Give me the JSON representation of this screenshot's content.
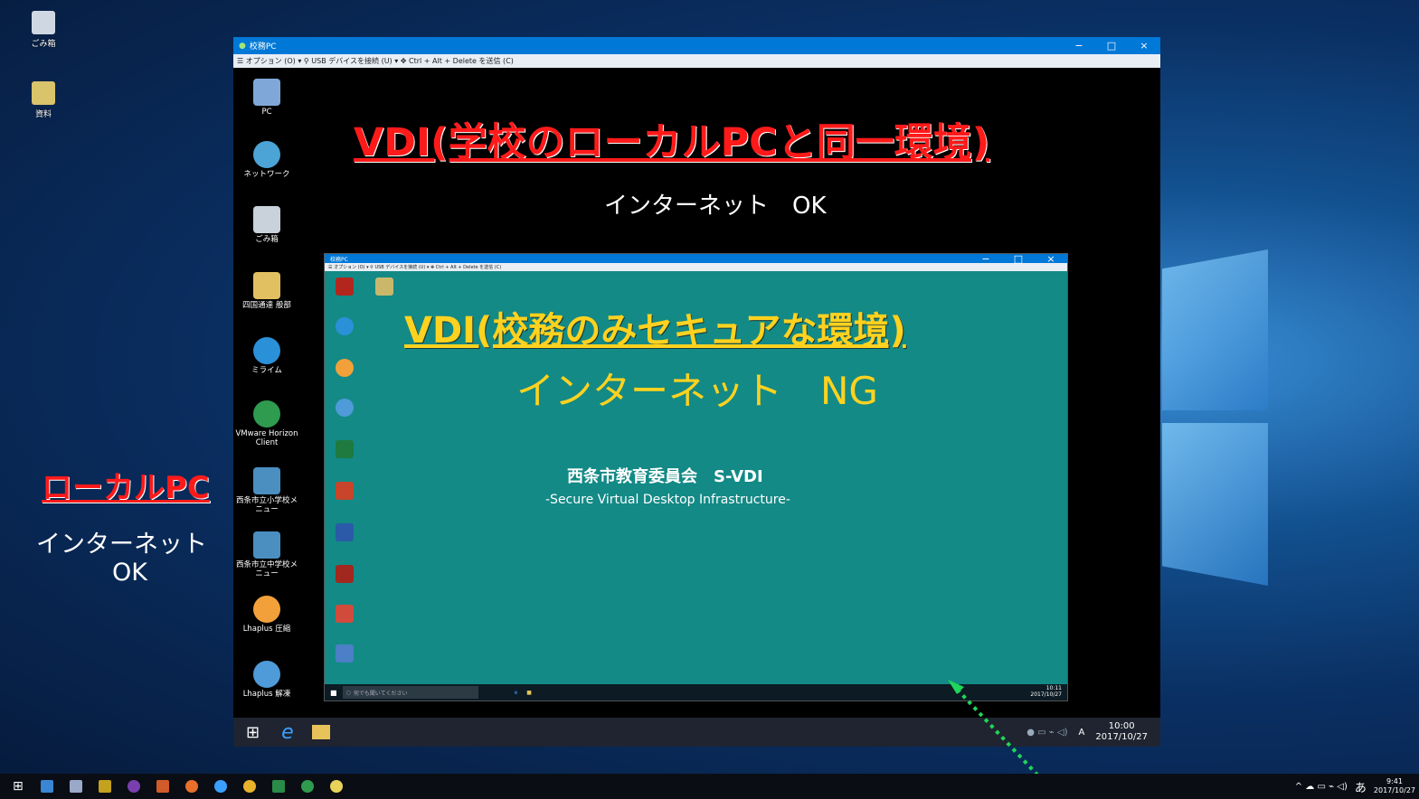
{
  "desktop": {
    "icons": [
      {
        "label": "ごみ箱",
        "icon": "recycle-bin-icon"
      },
      {
        "label": "資料",
        "icon": "folder-icon"
      }
    ],
    "local_title": "ローカルPC",
    "local_sub1": "インターネット",
    "local_sub2": "OK"
  },
  "outer": {
    "title": "校務PC",
    "menu": "☰ オプション (O) ▾ ⚲ USB デバイスを接続 (U) ▾ ✥ Ctrl + Alt + Delete を送信 (C)",
    "heading": "VDI(学校のローカルPCと同一環境)",
    "subheading": "インターネット　OK",
    "icons": [
      {
        "label": "PC",
        "icon": "computer-icon"
      },
      {
        "label": "ネットワーク",
        "icon": "network-icon"
      },
      {
        "label": "ごみ箱",
        "icon": "recycle-bin-icon"
      },
      {
        "label": "四国通達 般部",
        "icon": "folder-user-icon"
      },
      {
        "label": "ミライム",
        "icon": "ie-icon"
      },
      {
        "label": "VMware Horizon Client",
        "icon": "vmware-icon"
      },
      {
        "label": "西条市立小学校メニュー",
        "icon": "shortcut-icon"
      },
      {
        "label": "西条市立中学校メニュー",
        "icon": "shortcut-icon"
      },
      {
        "label": "Lhaplus 圧縮",
        "icon": "lhaplus-compress-icon"
      },
      {
        "label": "Lhaplus 解凍",
        "icon": "lhaplus-extract-icon"
      }
    ],
    "clock_time": "10:00",
    "clock_date": "2017/10/27",
    "ime": "A"
  },
  "inner": {
    "title": "校務PC",
    "menu": "☰ オプション (O) ▾ ⚲ USB デバイスを接続 (U) ▾ ✥ Ctrl + Alt + Delete を送信 (C)",
    "heading": "VDI(校務のみセキュアな環境)",
    "subheading": "インターネット　NG",
    "org": "西条市教育委員会　S-VDI",
    "org_sub": "-Secure Virtual Desktop Infrastructure-",
    "search_placeholder": "何でも聞いてください",
    "clock_time": "10:11",
    "clock_date": "2017/10/27"
  },
  "host": {
    "clock_time": "9:41",
    "clock_date": "2017/10/27",
    "ime": "あ"
  },
  "colors": {
    "red": "#ff1a1a",
    "yellow": "#ffd21f",
    "teal": "#138a86",
    "accent": "#0078d7"
  }
}
